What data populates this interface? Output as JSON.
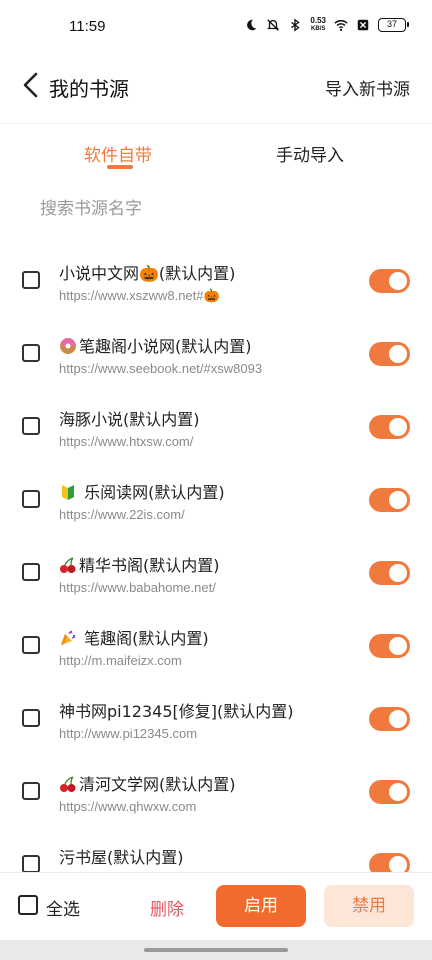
{
  "status_bar": {
    "time": "11:59",
    "net_speed_value": "0.53",
    "net_speed_unit": "KB/S",
    "battery": "37"
  },
  "header": {
    "title": "我的书源",
    "import_label": "导入新书源"
  },
  "tabs": {
    "builtin": "软件自带",
    "manual": "手动导入",
    "active": "builtin"
  },
  "search": {
    "placeholder": "搜索书源名字"
  },
  "sources": [
    {
      "prefix_icon": "",
      "name": "小说中文网🎃(默认内置)",
      "url": "https://www.xszww8.net#🎃",
      "checked": false,
      "enabled": true
    },
    {
      "prefix_icon": "donut",
      "name": "笔趣阁小说网(默认内置)",
      "url": "https://www.seebook.net/#xsw8093",
      "checked": false,
      "enabled": true
    },
    {
      "prefix_icon": "",
      "name": "海豚小说(默认内置)",
      "url": "https://www.htxsw.com/",
      "checked": false,
      "enabled": true
    },
    {
      "prefix_icon": "beginner",
      "name": "乐阅读网(默认内置)",
      "url": "https://www.22is.com/",
      "checked": false,
      "enabled": true
    },
    {
      "prefix_icon": "cherries",
      "name": "精华书阁(默认内置)",
      "url": "https://www.babahome.net/",
      "checked": false,
      "enabled": true
    },
    {
      "prefix_icon": "party-popper",
      "name": "笔趣阁(默认内置)",
      "url": "http://m.maifeizx.com",
      "checked": false,
      "enabled": true
    },
    {
      "prefix_icon": "",
      "name": "神书网pi12345[修复](默认内置)",
      "url": "http://www.pi12345.com",
      "checked": false,
      "enabled": true
    },
    {
      "prefix_icon": "cherries",
      "name": "清河文学网(默认内置)",
      "url": "https://www.qhwxw.com",
      "checked": false,
      "enabled": true
    },
    {
      "prefix_icon": "",
      "name": "污书屋(默认内置)",
      "url": "",
      "checked": false,
      "enabled": true
    }
  ],
  "bottom_bar": {
    "select_all": "全选",
    "delete": "删除",
    "enable": "启用",
    "disable": "禁用"
  },
  "colors": {
    "accent": "#f07a3d",
    "danger": "#e05a63",
    "disable_bg": "#fde5d8"
  }
}
